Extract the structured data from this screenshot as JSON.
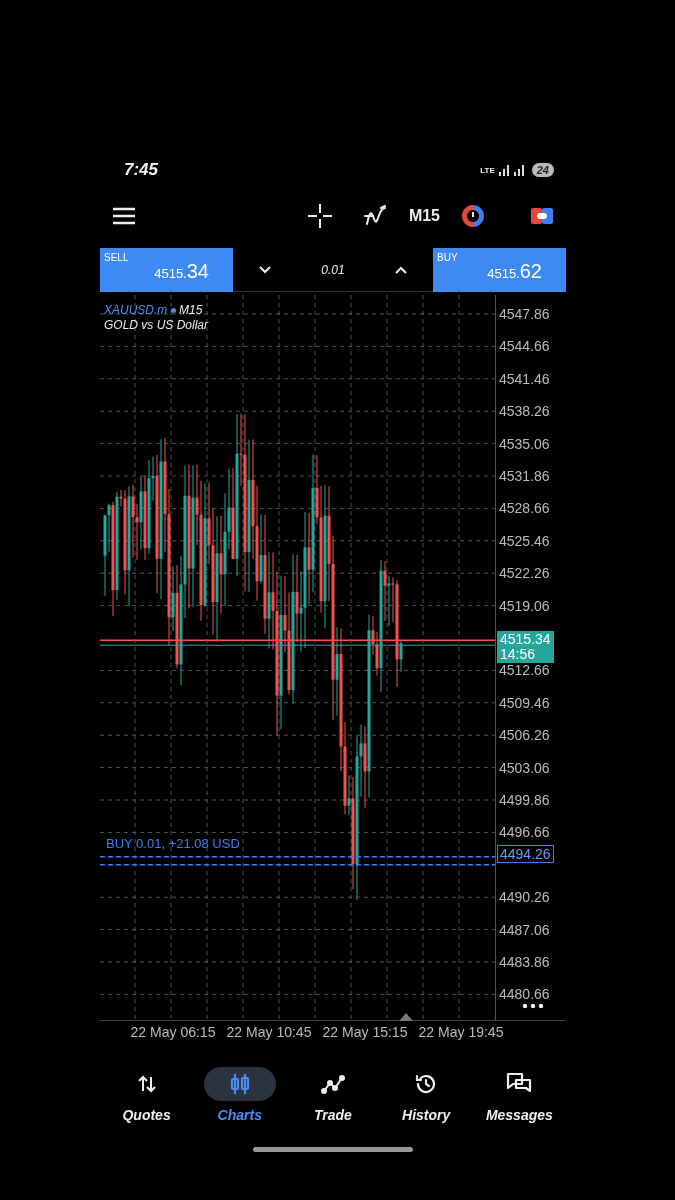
{
  "status_bar": {
    "time": "7:45",
    "network": "LTE",
    "battery": "24"
  },
  "toolbar": {
    "timeframe": "M15"
  },
  "trade_bar": {
    "sell": {
      "label": "SELL",
      "price": "4515.34"
    },
    "volume": "0.01",
    "buy": {
      "label": "BUY",
      "price": "4515.62"
    }
  },
  "chart": {
    "symbol": "XAUUSD.m",
    "timeframe": "M15",
    "description": "GOLD vs US Dollar",
    "price_levels": [
      "4547.86",
      "4544.66",
      "4541.46",
      "4538.26",
      "4535.06",
      "4531.86",
      "4528.66",
      "4525.46",
      "4522.26",
      "4519.06",
      "4512.66",
      "4509.46",
      "4506.26",
      "4503.06",
      "4499.86",
      "4496.66",
      "4490.26",
      "4487.06",
      "4483.86",
      "4480.66"
    ],
    "current_price": "4515.34",
    "countdown": "14:56",
    "position": {
      "label": "BUY 0.01, +21.08 USD",
      "price": "4494.26"
    },
    "time_labels": [
      "22 May 06:15",
      "22 May 10:45",
      "22 May 15:15",
      "22 May 19:45"
    ]
  },
  "nav": [
    {
      "label": "Quotes",
      "selected": false
    },
    {
      "label": "Charts",
      "selected": true
    },
    {
      "label": "Trade",
      "selected": false
    },
    {
      "label": "History",
      "selected": false
    },
    {
      "label": "Messages",
      "selected": false
    }
  ]
}
